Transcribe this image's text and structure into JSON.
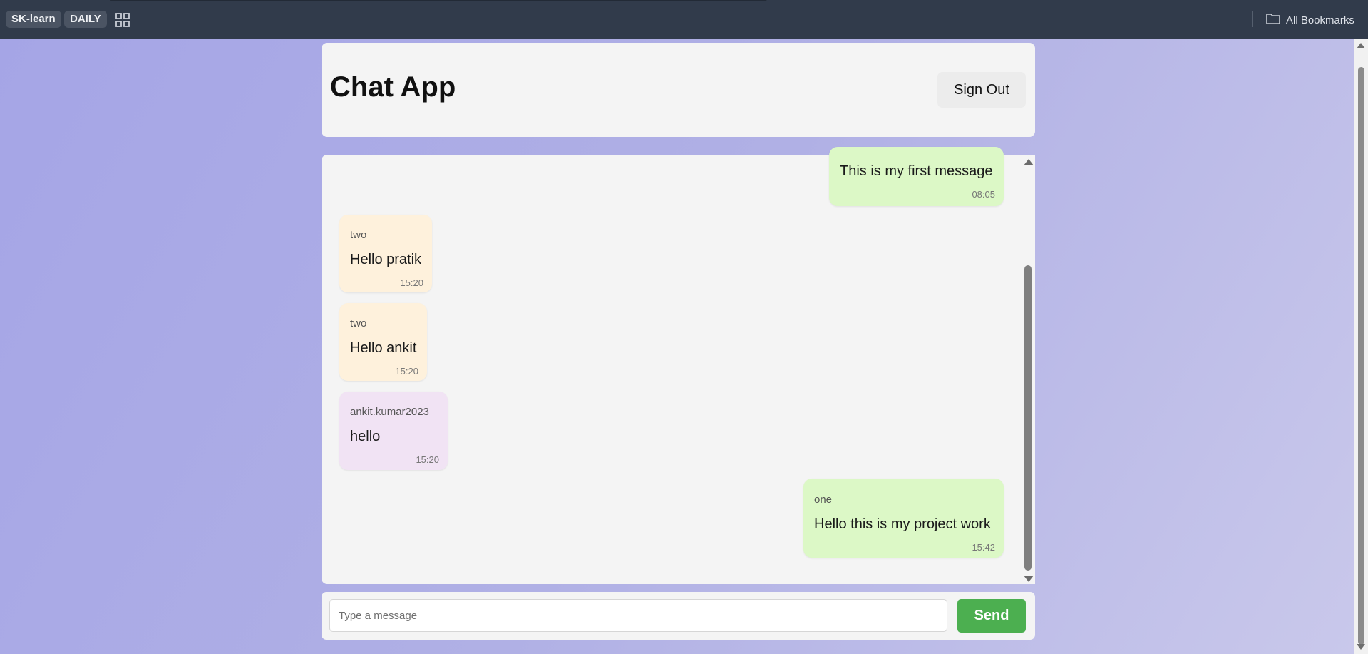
{
  "browser": {
    "bookmarks": [
      "SK-learn",
      "DAILY"
    ],
    "all_bookmarks_label": "All Bookmarks",
    "icons": [
      "apps-grid-icon",
      "folder-icon"
    ]
  },
  "header": {
    "title": "Chat App",
    "sign_out_label": "Sign Out"
  },
  "messages": [
    {
      "sender": "",
      "text": "This is my first message",
      "time": "08:05",
      "side": "right",
      "color": "#dcf8c6"
    },
    {
      "sender": "two",
      "text": "Hello pratik",
      "time": "15:20",
      "side": "left",
      "color": "#fef1dc"
    },
    {
      "sender": "two",
      "text": "Hello ankit",
      "time": "15:20",
      "side": "left",
      "color": "#fef1dc"
    },
    {
      "sender": "ankit.kumar2023",
      "text": "hello",
      "time": "15:20",
      "side": "left",
      "color": "#f1e3f4"
    },
    {
      "sender": "one",
      "text": "Hello this is my project work",
      "time": "15:42",
      "side": "right",
      "color": "#dcf8c6"
    }
  ],
  "composer": {
    "placeholder": "Type a message",
    "value": "",
    "send_label": "Send"
  },
  "colors": {
    "send_button": "#4caf50",
    "outgoing_bubble": "#dcf8c6",
    "incoming_bubble": "#fef1dc",
    "incoming_bubble_alt": "#f1e3f4"
  }
}
